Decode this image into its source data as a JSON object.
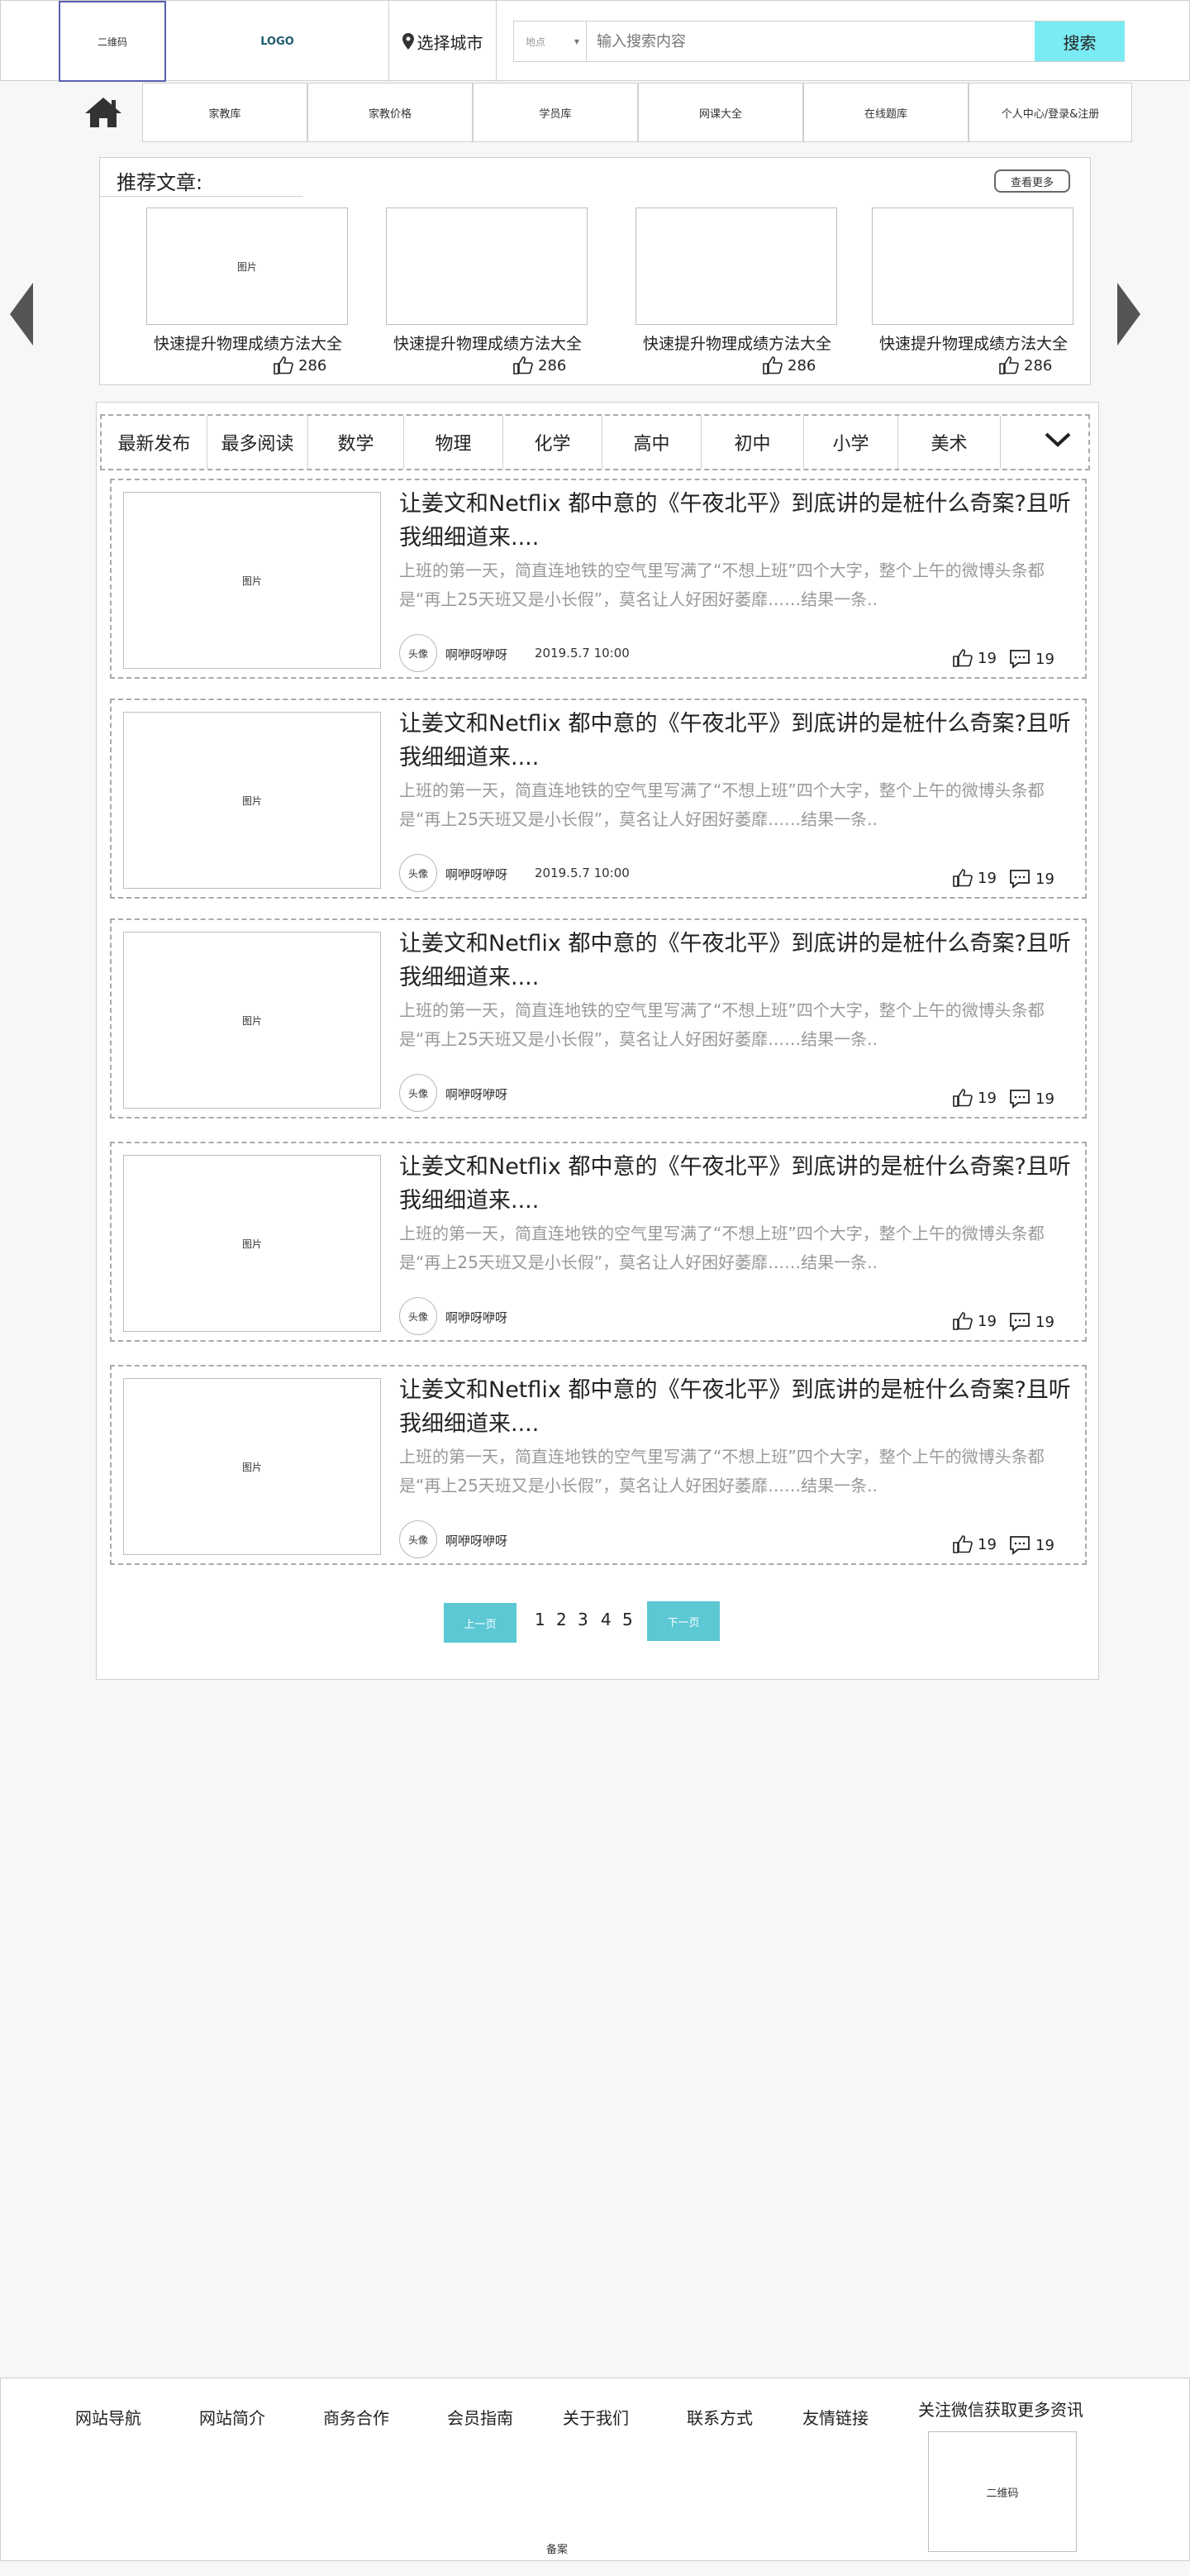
{
  "header": {
    "qr_label": "二维码",
    "logo_label": "LOGO",
    "city_label": "选择城市",
    "location_select": "地点",
    "search_placeholder": "输入搜索内容",
    "search_button": "搜索"
  },
  "nav": {
    "items": [
      {
        "label": "家教库"
      },
      {
        "label": "家教价格"
      },
      {
        "label": "学员库"
      },
      {
        "label": "网课大全"
      },
      {
        "label": "在线题库"
      },
      {
        "label": "个人中心/登录&注册"
      }
    ]
  },
  "recommend": {
    "title": "推荐文章:",
    "more_button": "查看更多",
    "cards": [
      {
        "image_label": "图片",
        "caption": "快速提升物理成绩方法大全",
        "likes": "286"
      },
      {
        "image_label": "",
        "caption": "快速提升物理成绩方法大全",
        "likes": "286"
      },
      {
        "image_label": "",
        "caption": "快速提升物理成绩方法大全",
        "likes": "286"
      },
      {
        "image_label": "",
        "caption": "快速提升物理成绩方法大全",
        "likes": "286"
      }
    ]
  },
  "tabs": [
    "最新发布",
    "最多阅读",
    "数学",
    "物理",
    "化学",
    "高中",
    "初中",
    "小学",
    "美术"
  ],
  "articles": [
    {
      "image_label": "图片",
      "title": "让姜文和Netflix 都中意的《午夜北平》到底讲的是桩什么奇案?且听我细细道来....",
      "desc": "上班的第一天，简直连地铁的空气里写满了“不想上班”四个大字，整个上午的微博头条都是“再上25天班又是小长假”，莫名让人好困好萎靡……结果一条..",
      "avatar": "头像",
      "author": "啊咿呀咿呀",
      "date": "2019.5.7 10:00",
      "likes": "19",
      "comments": "19"
    },
    {
      "image_label": "图片",
      "title": "让姜文和Netflix 都中意的《午夜北平》到底讲的是桩什么奇案?且听我细细道来....",
      "desc": "上班的第一天，简直连地铁的空气里写满了“不想上班”四个大字，整个上午的微博头条都是“再上25天班又是小长假”，莫名让人好困好萎靡……结果一条..",
      "avatar": "头像",
      "author": "啊咿呀咿呀",
      "date": "2019.5.7 10:00",
      "likes": "19",
      "comments": "19"
    },
    {
      "image_label": "图片",
      "title": "让姜文和Netflix 都中意的《午夜北平》到底讲的是桩什么奇案?且听我细细道来....",
      "desc": "上班的第一天，简直连地铁的空气里写满了“不想上班”四个大字，整个上午的微博头条都是“再上25天班又是小长假”，莫名让人好困好萎靡……结果一条..",
      "avatar": "头像",
      "author": "啊咿呀咿呀",
      "date": "",
      "likes": "19",
      "comments": "19"
    },
    {
      "image_label": "图片",
      "title": "让姜文和Netflix 都中意的《午夜北平》到底讲的是桩什么奇案?且听我细细道来....",
      "desc": "上班的第一天，简直连地铁的空气里写满了“不想上班”四个大字，整个上午的微博头条都是“再上25天班又是小长假”，莫名让人好困好萎靡……结果一条..",
      "avatar": "头像",
      "author": "啊咿呀咿呀",
      "date": "",
      "likes": "19",
      "comments": "19"
    },
    {
      "image_label": "图片",
      "title": "让姜文和Netflix 都中意的《午夜北平》到底讲的是桩什么奇案?且听我细细道来....",
      "desc": "上班的第一天，简直连地铁的空气里写满了“不想上班”四个大字，整个上午的微博头条都是“再上25天班又是小长假”，莫名让人好困好萎靡……结果一条..",
      "avatar": "头像",
      "author": "啊咿呀咿呀",
      "date": "",
      "likes": "19",
      "comments": "19"
    }
  ],
  "pagination": {
    "prev": "上一页",
    "pages": [
      "1",
      "2",
      "3",
      "4",
      "5"
    ],
    "next": "下一页"
  },
  "footer": {
    "links": [
      "网站导航",
      "网站简介",
      "商务合作",
      "会员指南",
      "关于我们",
      "联系方式",
      "友情链接",
      "关注微信获取更多资讯"
    ],
    "qr_label": "二维码",
    "beian": "备案"
  },
  "colors": {
    "search_button": "#7aeaf3",
    "pager_button": "#5bc8d4",
    "qr_border": "#5860b0"
  }
}
